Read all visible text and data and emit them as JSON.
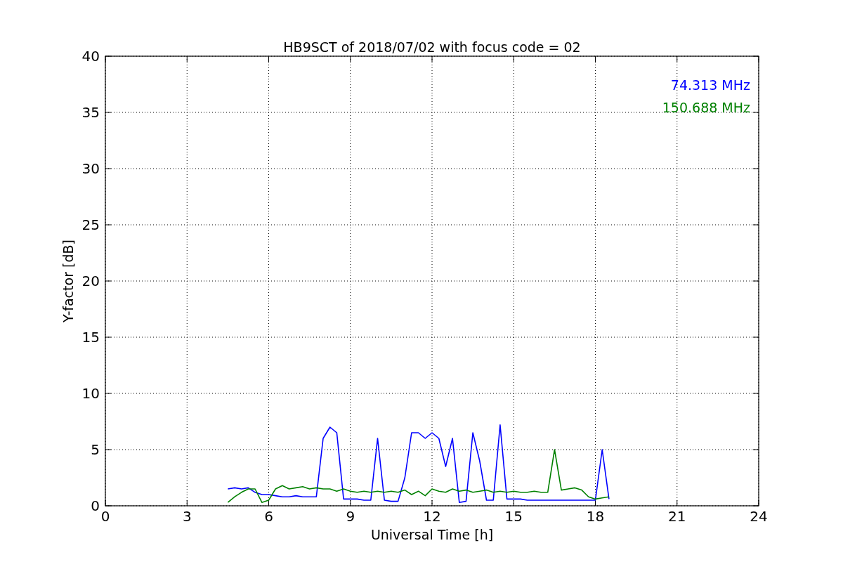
{
  "chart": {
    "chart_data": {
      "type": "line",
      "title": "HB9SCT of 2018/07/02 with focus code = 02",
      "xlabel": "Universal Time [h]",
      "ylabel": "Y-factor [dB]",
      "x": [
        4.5,
        4.75,
        5,
        5.25,
        5.5,
        5.75,
        6,
        6.25,
        6.5,
        6.75,
        7,
        7.25,
        7.5,
        7.75,
        8,
        8.25,
        8.5,
        8.75,
        9,
        9.25,
        9.5,
        9.75,
        10,
        10.25,
        10.5,
        10.75,
        11,
        11.25,
        11.5,
        11.75,
        12,
        12.25,
        12.5,
        12.75,
        13,
        13.25,
        13.5,
        13.75,
        14,
        14.25,
        14.5,
        14.75,
        15,
        15.25,
        15.5,
        15.75,
        16,
        16.25,
        16.5,
        16.75,
        17,
        17.25,
        17.5,
        17.75,
        18,
        18.25,
        18.5
      ],
      "series": [
        {
          "name": "74.313 MHz",
          "color": "#0000ff",
          "values": [
            1.5,
            1.6,
            1.5,
            1.6,
            1.2,
            1.0,
            1.0,
            0.9,
            0.8,
            0.8,
            0.9,
            0.8,
            0.8,
            0.8,
            6.0,
            7.0,
            6.5,
            0.6,
            0.6,
            0.6,
            0.5,
            0.5,
            6.0,
            0.5,
            0.4,
            0.4,
            2.5,
            6.5,
            6.5,
            6.0,
            6.5,
            6.0,
            3.5,
            6.0,
            0.3,
            0.4,
            6.5,
            4.0,
            0.5,
            0.5,
            7.2,
            0.6,
            0.6,
            0.6,
            0.5,
            0.5,
            0.5,
            0.5,
            0.5,
            0.5,
            0.5,
            0.5,
            0.5,
            0.5,
            0.5,
            5.0,
            0.6
          ]
        },
        {
          "name": "150.688 MHz",
          "color": "#008000",
          "values": [
            0.3,
            0.8,
            1.2,
            1.5,
            1.5,
            0.3,
            0.5,
            1.5,
            1.8,
            1.5,
            1.6,
            1.7,
            1.5,
            1.6,
            1.5,
            1.5,
            1.3,
            1.5,
            1.3,
            1.2,
            1.3,
            1.2,
            1.3,
            1.2,
            1.3,
            1.2,
            1.4,
            1.0,
            1.3,
            0.9,
            1.5,
            1.3,
            1.2,
            1.5,
            1.3,
            1.4,
            1.2,
            1.3,
            1.4,
            1.2,
            1.3,
            1.2,
            1.3,
            1.2,
            1.2,
            1.3,
            1.2,
            1.2,
            5.0,
            1.4,
            1.5,
            1.6,
            1.4,
            0.8,
            0.6,
            0.7,
            0.8
          ]
        }
      ],
      "xlim": [
        0,
        24
      ],
      "ylim": [
        0,
        40
      ],
      "xticks": [
        0,
        3,
        6,
        9,
        12,
        15,
        18,
        21,
        24
      ],
      "yticks": [
        0,
        5,
        10,
        15,
        20,
        25,
        30,
        35,
        40
      ],
      "grid": true
    }
  }
}
